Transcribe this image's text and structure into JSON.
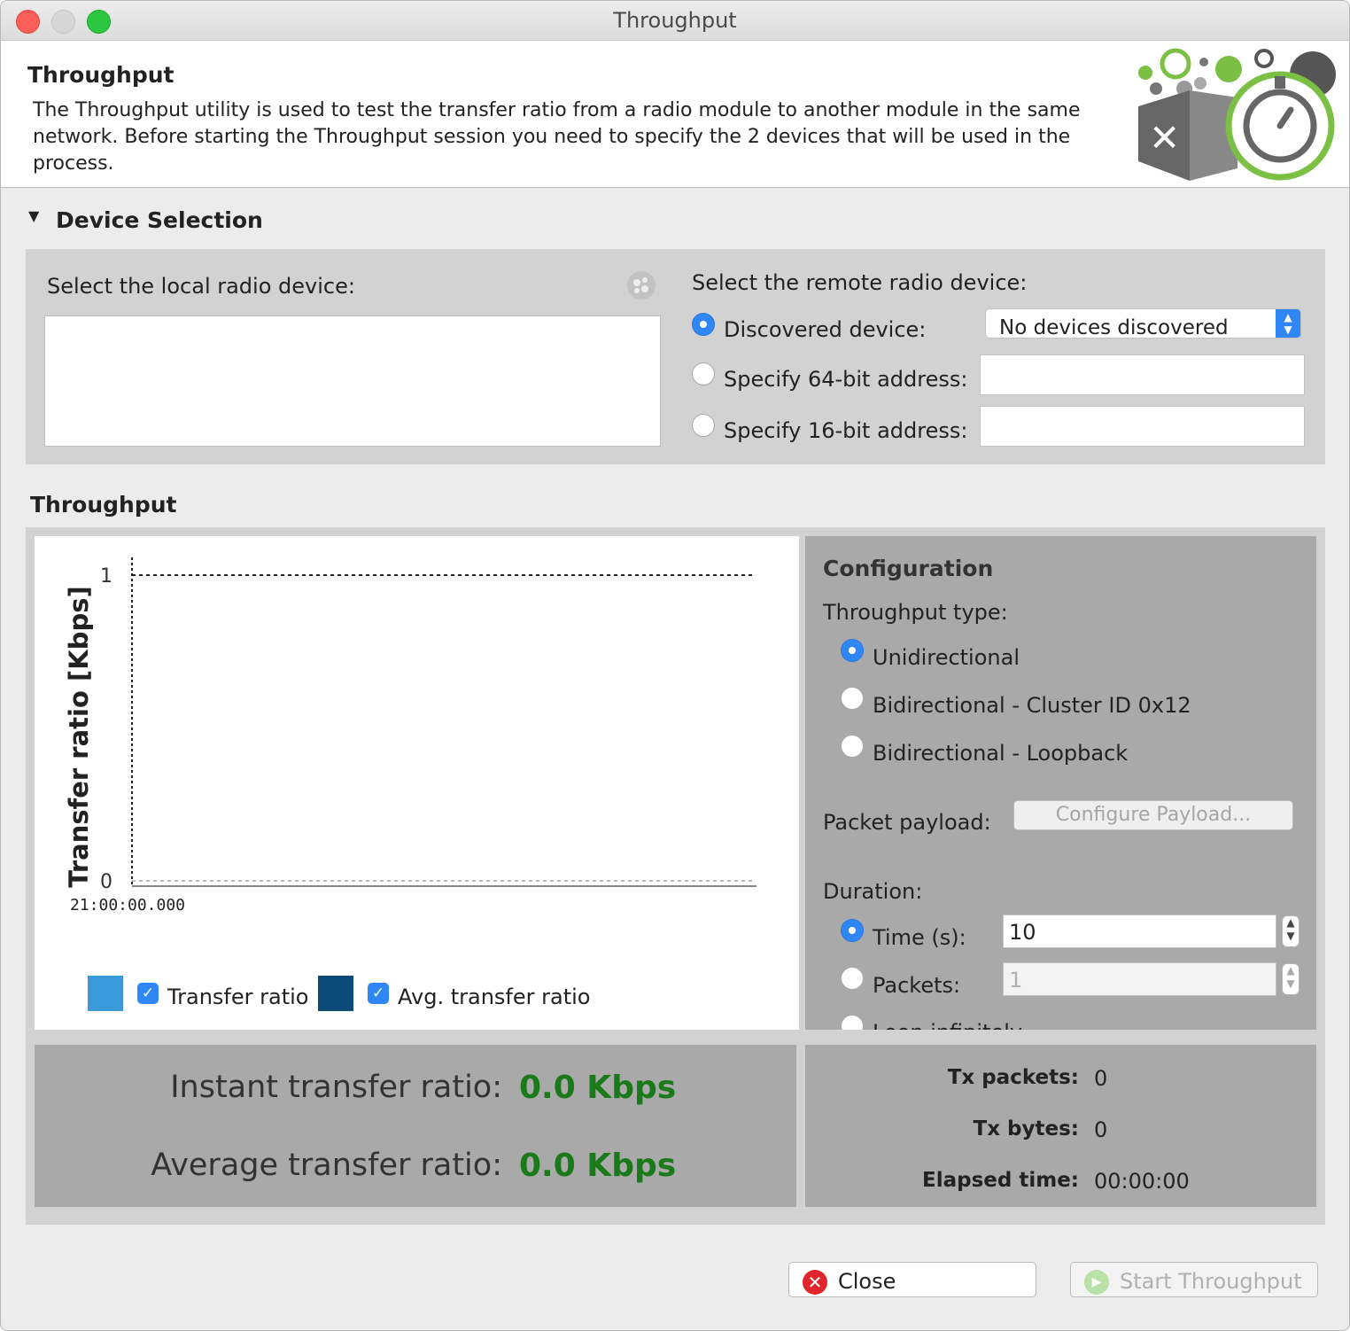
{
  "window": {
    "title": "Throughput"
  },
  "header": {
    "title": "Throughput",
    "description": "The Throughput utility is used to test the transfer ratio from a radio module to another module in the same network. Before starting the Throughput session you need to specify the 2 devices that will be used in the process."
  },
  "device_selection": {
    "title": "Device Selection",
    "local_label": "Select the local radio device:",
    "remote_label": "Select the remote radio device:",
    "discovered_label": "Discovered device:",
    "discovered_value": "No devices discovered",
    "addr64_label": "Specify 64-bit address:",
    "addr64_value": "",
    "addr16_label": "Specify 16-bit address:",
    "addr16_value": ""
  },
  "throughput": {
    "title": "Throughput",
    "chart_data": {
      "type": "line",
      "title": "",
      "xlabel": "",
      "ylabel": "Transfer ratio [Kbps]",
      "ylim": [
        0,
        1
      ],
      "y_ticks": [
        "1",
        "0"
      ],
      "x_ticks": [
        "21:00:00.000"
      ],
      "series": [
        {
          "name": "Transfer ratio",
          "color": "#3a9ad9",
          "values": []
        },
        {
          "name": "Avg. transfer ratio",
          "color": "#0c4a78",
          "values": []
        }
      ],
      "legend_position": "bottom"
    },
    "legend": {
      "transfer": "Transfer ratio",
      "avg": "Avg. transfer ratio"
    }
  },
  "configuration": {
    "title": "Configuration",
    "type_label": "Throughput type:",
    "types": [
      "Unidirectional",
      "Bidirectional - Cluster ID 0x12",
      "Bidirectional - Loopback"
    ],
    "payload_label": "Packet payload:",
    "payload_button": "Configure Payload...",
    "duration_label": "Duration:",
    "time_label": "Time (s):",
    "time_value": "10",
    "packets_label": "Packets:",
    "packets_value": "1",
    "loop_label": "Loop infinitely"
  },
  "stats": {
    "instant_label": "Instant transfer ratio:",
    "instant_value": "0.0 Kbps",
    "average_label": "Average transfer ratio:",
    "average_value": "0.0 Kbps",
    "tx_packets_label": "Tx packets:",
    "tx_packets_value": "0",
    "tx_bytes_label": "Tx bytes:",
    "tx_bytes_value": "0",
    "elapsed_label": "Elapsed time:",
    "elapsed_value": "00:00:00"
  },
  "footer": {
    "close_label": "Close",
    "start_label": "Start Throughput"
  },
  "colors": {
    "accent": "#2f86f5",
    "value_green": "#1a7a1a",
    "series1": "#3a9ad9",
    "series2": "#0c4a78",
    "close_red": "#e0262c"
  }
}
